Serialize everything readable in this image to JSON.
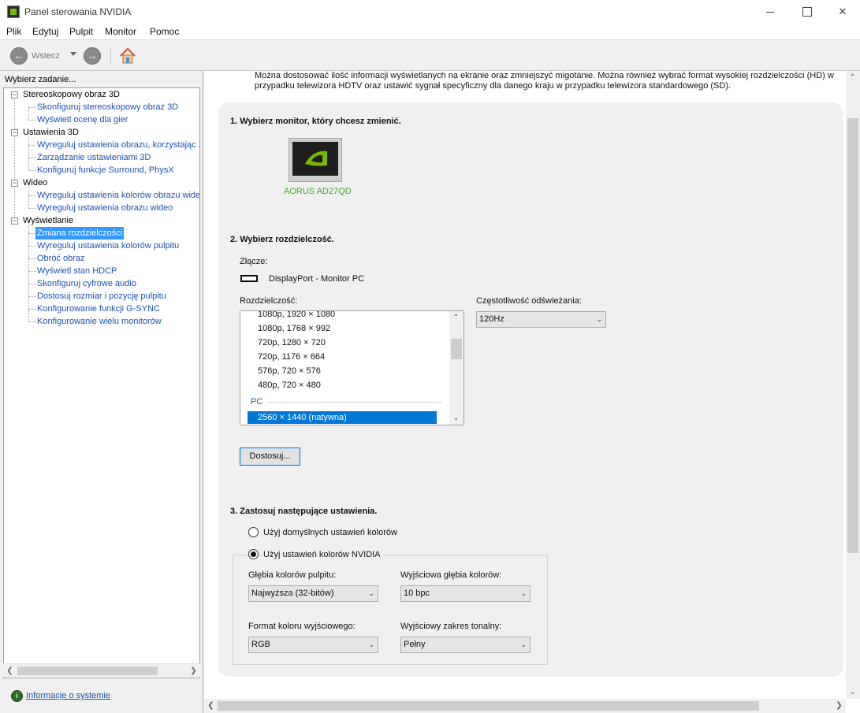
{
  "window": {
    "title": "Panel sterowania NVIDIA"
  },
  "menu": {
    "items": [
      "Plik",
      "Edytuj",
      "Pulpit",
      "Monitor",
      "Pomoc"
    ]
  },
  "toolbar": {
    "back_label": "Wstecz"
  },
  "sidebar": {
    "task_label": "Wybierz zadanie...",
    "categories": [
      {
        "label": "Stereoskopowy obraz 3D",
        "items": [
          "Skonfiguruj stereoskopowy obraz 3D",
          "Wyświetl ocenę dla gier"
        ]
      },
      {
        "label": "Ustawienia 3D",
        "items": [
          "Wyreguluj ustawienia obrazu, korzystając z",
          "Zarządzanie ustawieniami 3D",
          "Konfiguruj funkcje Surround, PhysX"
        ]
      },
      {
        "label": "Wideo",
        "items": [
          "Wyreguluj ustawienia kolorów obrazu wideo",
          "Wyreguluj ustawienia obrazu wideo"
        ]
      },
      {
        "label": "Wyświetlanie",
        "items": [
          "Zmiana rozdzielczości",
          "Wyreguluj ustawienia kolorów pulpitu",
          "Obróć obraz",
          "Wyświetl stan HDCP",
          "Skonfiguruj cyfrowe audio",
          "Dostosuj rozmiar i pozycję pulpitu",
          "Konfigurowanie funkcji G-SYNC",
          "Konfigurowanie wielu monitorów"
        ]
      }
    ],
    "selected_item": "Zmiana rozdzielczości",
    "system_info_link": "Informacje o systemie"
  },
  "main": {
    "description": "Można dostosować ilość informacji wyświetlanych na ekranie oraz zmniejszyć migotanie. Można również wybrać format wysokiej rozdzielczości (HD) w przypadku telewizora HDTV oraz ustawić sygnał specyficzny dla danego kraju w przypadku telewizora standardowego (SD).",
    "step1": {
      "title": "1. Wybierz monitor, który chcesz zmienić.",
      "monitor_name": "AORUS AD27QD"
    },
    "step2": {
      "title": "2. Wybierz rozdzielczość.",
      "connector_label": "Złącze:",
      "connector_value": "DisplayPort - Monitor PC",
      "resolution_label": "Rozdzielczość:",
      "resolutions": [
        "1080p, 1920 × 1080",
        "1080p, 1768 × 992",
        "720p, 1280 × 720",
        "720p, 1176 × 664",
        "576p, 720 × 576",
        "480p, 720 × 480"
      ],
      "pc_group_label": "PC",
      "selected_resolution": "2560 × 1440 (natywna)",
      "refresh_label": "Częstotliwość odświeżania:",
      "refresh_value": "120Hz",
      "customize_button": "Dostosuj..."
    },
    "step3": {
      "title": "3. Zastosuj następujące ustawienia.",
      "radio_default": "Użyj domyślnych ustawień kolorów",
      "radio_nvidia": "Użyj ustawień kolorów NVIDIA",
      "selected_radio": "nvidia",
      "desktop_depth_label": "Głębia kolorów pulpitu:",
      "desktop_depth_value": "Najwyższa (32-bitów)",
      "output_depth_label": "Wyjściowa głębia kolorów:",
      "output_depth_value": "10 bpc",
      "output_format_label": "Format koloru wyjściowego:",
      "output_format_value": "RGB",
      "output_range_label": "Wyjściowy zakres tonalny:",
      "output_range_value": "Pełny"
    }
  },
  "colors": {
    "accent": "#0078d7",
    "link": "#1a52b3",
    "nvidia_green": "#76b900",
    "monitor_label": "#3daa25"
  },
  "icons": {
    "back": "arrow-left-icon",
    "forward": "arrow-right-icon",
    "home": "home-icon",
    "connector": "displayport-icon",
    "system_info": "system-info-icon"
  }
}
